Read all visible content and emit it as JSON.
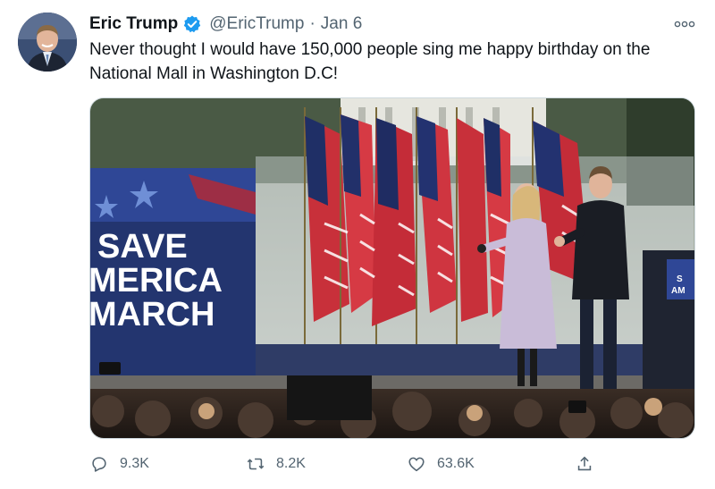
{
  "author": {
    "name": "Eric Trump",
    "handle": "@EricTrump",
    "separator": "·",
    "date": "Jan 6"
  },
  "tweet": {
    "text_line1": "Never thought I would have 150,000 people sing me happy birthday on the",
    "text_line2": "National Mall in Washington D.C!"
  },
  "media": {
    "sign_line1": "SAVE",
    "sign_line2": "MERICA",
    "sign_line3": "MARCH",
    "podium_text_top": "S",
    "podium_text_bottom": "AM"
  },
  "actions": {
    "replies": "9.3K",
    "retweets": "8.2K",
    "likes": "63.6K"
  },
  "colors": {
    "verified": "#1d9bf0",
    "muted": "#536471",
    "text": "#0f1419"
  }
}
